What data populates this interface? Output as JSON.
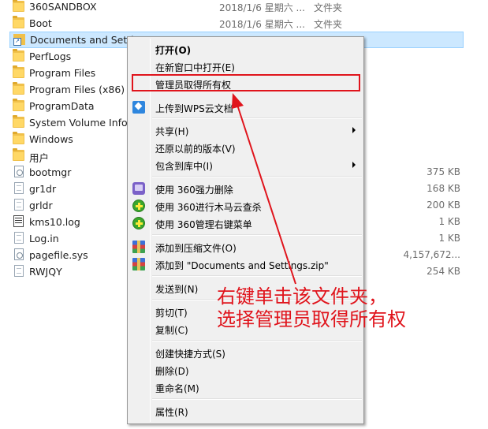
{
  "files": [
    {
      "name": "360SANDBOX",
      "date": "2018/1/6 星期六 ...",
      "type": "文件夹",
      "size": "",
      "icon": "folder-icon"
    },
    {
      "name": "Boot",
      "date": "2018/1/6 星期六 ...",
      "type": "文件夹",
      "size": "",
      "icon": "folder-icon"
    },
    {
      "name": "Documents and Settings",
      "date": "",
      "type": "",
      "size": "",
      "icon": "folder-shortcut-icon"
    },
    {
      "name": "PerfLogs",
      "date": "",
      "type": "",
      "size": "",
      "icon": "folder-icon"
    },
    {
      "name": "Program Files",
      "date": "",
      "type": "",
      "size": "",
      "icon": "folder-icon"
    },
    {
      "name": "Program Files (x86)",
      "date": "",
      "type": "",
      "size": "",
      "icon": "folder-icon"
    },
    {
      "name": "ProgramData",
      "date": "",
      "type": "",
      "size": "",
      "icon": "folder-icon"
    },
    {
      "name": "System Volume Infor",
      "date": "",
      "type": "",
      "size": "",
      "icon": "folder-icon"
    },
    {
      "name": "Windows",
      "date": "",
      "type": "",
      "size": "",
      "icon": "folder-icon"
    },
    {
      "name": "用户",
      "date": "",
      "type": "",
      "size": "",
      "icon": "folder-icon"
    },
    {
      "name": "bootmgr",
      "date": "",
      "type": "",
      "size": "375 KB",
      "icon": "system-file-icon"
    },
    {
      "name": "gr1dr",
      "date": "",
      "type": "",
      "size": "168 KB",
      "icon": "file-icon"
    },
    {
      "name": "grldr",
      "date": "",
      "type": "",
      "size": "200 KB",
      "icon": "file-icon"
    },
    {
      "name": "kms10.log",
      "date": "",
      "type": "",
      "size": "1 KB",
      "icon": "log-file-icon"
    },
    {
      "name": "Log.in",
      "date": "",
      "type": "",
      "size": "1 KB",
      "icon": "file-icon"
    },
    {
      "name": "pagefile.sys",
      "date": "",
      "type": "",
      "size": "4,157,672...",
      "icon": "system-file-icon"
    },
    {
      "name": "RWJQY",
      "date": "",
      "type": "",
      "size": "254 KB",
      "icon": "file-icon"
    }
  ],
  "context_menu": {
    "open": "打开(O)",
    "open_new_window": "在新窗口中打开(E)",
    "take_ownership": "管理员取得所有权",
    "upload_wps": "上传到WPS云文档",
    "share": "共享(H)",
    "restore_previous": "还原以前的版本(V)",
    "include_in_library": "包含到库中(I)",
    "force_delete_360": "使用 360强力删除",
    "trojan_scan_360": "使用 360进行木马云查杀",
    "manage_menu_360": "使用 360管理右键菜单",
    "add_to_archive": "添加到压缩文件(O)",
    "add_to_zip": "添加到 \"Documents and Settings.zip\"",
    "send_to": "发送到(N)",
    "cut": "剪切(T)",
    "copy": "复制(C)",
    "create_shortcut": "创建快捷方式(S)",
    "delete": "删除(D)",
    "rename": "重命名(M)",
    "properties": "属性(R)"
  },
  "annotation": {
    "line1": "右键单击该文件夹，",
    "line2": "选择管理员取得所有权"
  },
  "colors": {
    "selection": "#cce8ff",
    "highlight_red": "#e0141c",
    "menu_background": "#f0f0f0"
  }
}
